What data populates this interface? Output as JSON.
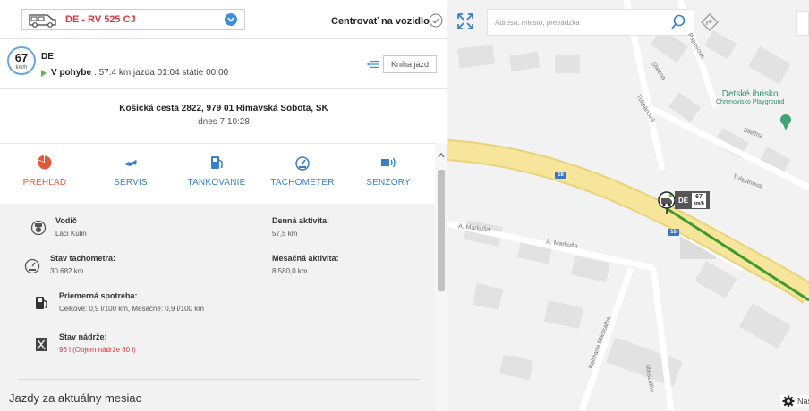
{
  "header": {
    "vehicle_plate": "DE - RV 525 CJ",
    "center_label": "Centrovať na vozidlo"
  },
  "status": {
    "speed": "67",
    "speed_unit": "km/h",
    "country": "DE",
    "state": "V pohybe",
    "details": ". 57.4 km jazda 01:04 státie 00:00",
    "logbook_button": "Kniha jázd"
  },
  "address": {
    "line": "Košická cesta 2822, 979 01 Rimavská Sobota, SK",
    "time": "dnes  7:10:28"
  },
  "tabs": [
    {
      "label": "PREHĽAD",
      "icon": "pie-chart-icon",
      "active": true
    },
    {
      "label": "SERVIS",
      "icon": "wrench-icon",
      "active": false
    },
    {
      "label": "TANKOVANIE",
      "icon": "fuel-pump-icon",
      "active": false
    },
    {
      "label": "TACHOMETER",
      "icon": "speedometer-icon",
      "active": false
    },
    {
      "label": "SENZORY",
      "icon": "sensor-icon",
      "active": false
    }
  ],
  "overview": {
    "driver_label": "Vodič",
    "driver_value": "Laci Kulin",
    "daily_label": "Denná aktivita:",
    "daily_value": "57,5 km",
    "odo_label": "Stav tachometra:",
    "odo_value": "30 682 km",
    "monthly_label": "Mesačná aktivita:",
    "monthly_value": "8 580,0 km",
    "consumption_label": "Priemerná spotreba:",
    "consumption_value": "Celkové: 0,9 l/100 km, Mesačné: 0,9 l/100 km",
    "tank_label": "Stav nádrže:",
    "tank_value": "96 l (Objem nádrže 80 l)"
  },
  "section_title": "Jazdy za aktuálny mesiac",
  "map": {
    "search_placeholder": "Adresa, miesto, prevádzka",
    "poi_name": "Detské ihrisko",
    "poi_sub": "Chrenovisko Playground",
    "streets": [
      "Sliezna",
      "Pápavova",
      "Tulipánová",
      "Sliežna",
      "Tulipánova",
      "A. Markuša",
      "A. Markuša",
      "Kalmana Mikszatha",
      "Mikszátha"
    ],
    "road_number": "16",
    "vehicle_country": "DE",
    "vehicle_speed": "67",
    "vehicle_speed_unit": "km/h",
    "settings_label": "Nas"
  },
  "colors": {
    "plate_red": "#d9363e",
    "accent_blue": "#3a7fc1",
    "active_tab": "#e05a3a",
    "route_green": "#3f9a2f",
    "road_yellow": "#f6e59a"
  }
}
